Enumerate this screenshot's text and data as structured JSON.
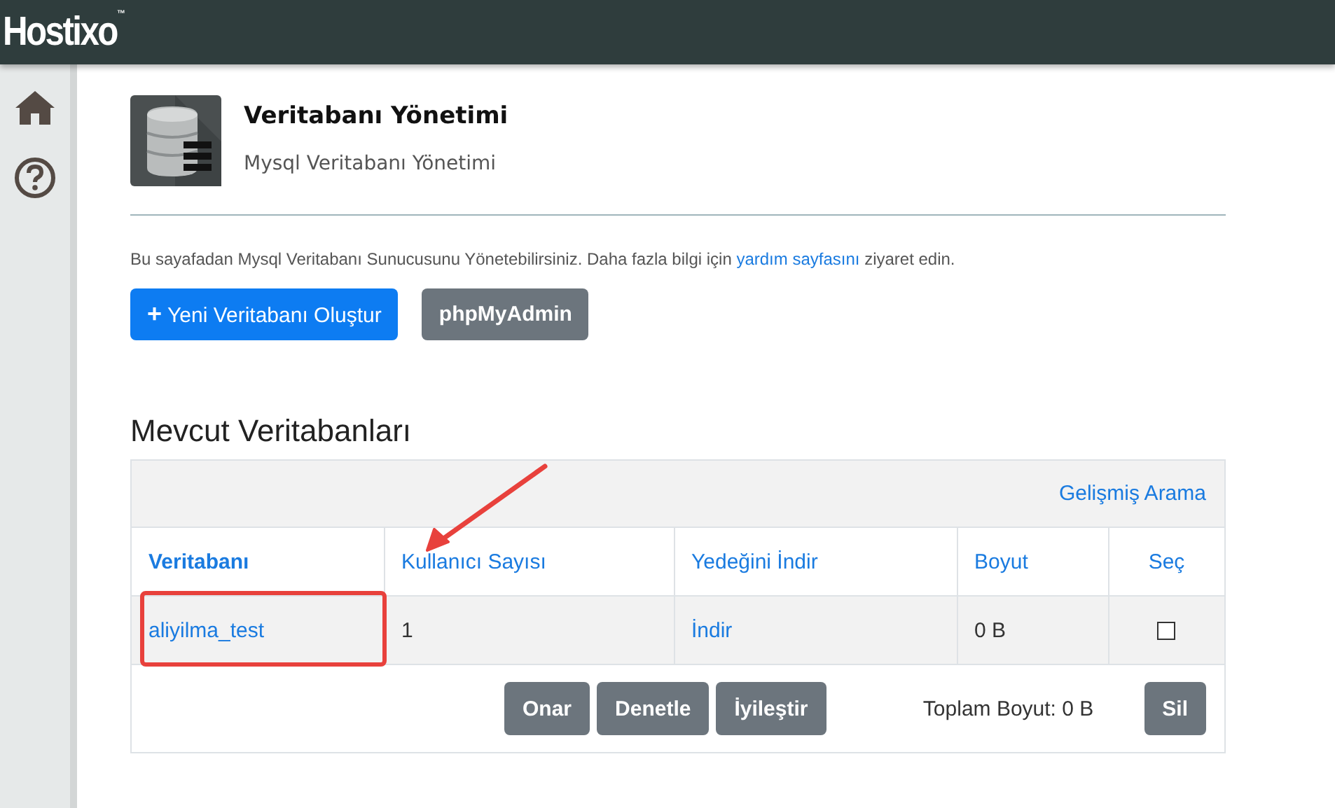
{
  "header": {
    "logo": "Hostixo",
    "logo_mark": "™"
  },
  "sidebar": {
    "items": [
      {
        "kind": "home"
      },
      {
        "kind": "help"
      }
    ]
  },
  "page": {
    "title": "Veritabanı Yönetimi",
    "subtitle": "Mysql Veritabanı Yönetimi"
  },
  "intro": {
    "before": "Bu sayafadan Mysql Veritabanı Sunucusunu Yönetebilirsiniz. Daha fazla bilgi için",
    "link": "yardım sayfasını",
    "after": "ziyaret edin."
  },
  "buttons": [
    {
      "label": "Yeni Veritabanı Oluştur",
      "kind": "primary",
      "icon": "+"
    },
    {
      "label": "phpMyAdmin",
      "kind": "secondary"
    }
  ],
  "section_title": "Mevcut Veritabanları",
  "table": {
    "toolbar_link": "Gelişmiş Arama",
    "columns": [
      {
        "label": "Veritabanı",
        "sorted": true
      },
      {
        "label": "Kullanıcı Sayısı",
        "sorted": false
      },
      {
        "label": "Yedeğini İndir",
        "sorted": false
      },
      {
        "label": "Boyut",
        "sorted": false
      },
      {
        "label": "Seç",
        "sorted": false
      }
    ],
    "rows": [
      {
        "name": "aliyilma_test",
        "users": "1",
        "backup": "İndir",
        "size": "0 B",
        "checked": false
      }
    ],
    "actions": [
      "Onar",
      "Denetle",
      "İyileştir"
    ],
    "total": "Toplam Boyut: 0 B",
    "delete": "Sil"
  }
}
